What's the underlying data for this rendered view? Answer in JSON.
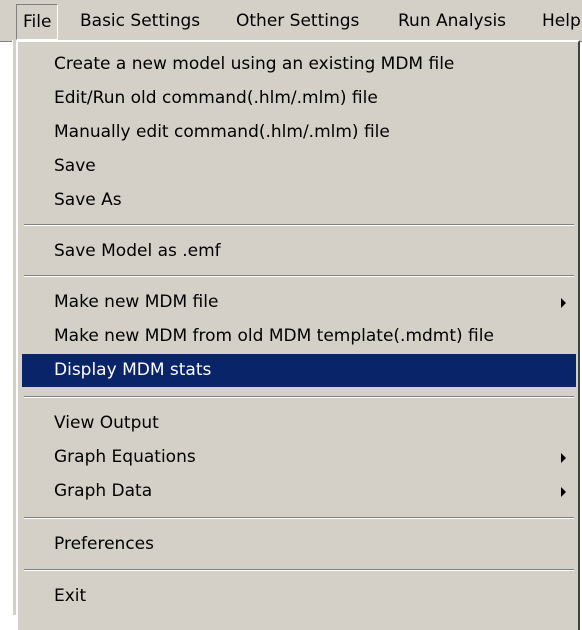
{
  "menubar": {
    "items": [
      {
        "label": "File"
      },
      {
        "label": "Basic Settings"
      },
      {
        "label": "Other Settings"
      },
      {
        "label": "Run Analysis"
      },
      {
        "label": "Help"
      }
    ]
  },
  "file_menu": {
    "items": [
      {
        "label": "Create a new model using an existing MDM file"
      },
      {
        "label": "Edit/Run old command(.hlm/.mlm) file"
      },
      {
        "label": "Manually edit command(.hlm/.mlm) file"
      },
      {
        "label": "Save"
      },
      {
        "label": "Save As"
      },
      {
        "label": "Save Model as .emf"
      },
      {
        "label": "Make new MDM file",
        "submenu_icon": "submenu-arrow-icon"
      },
      {
        "label": "Make new MDM from old MDM template(.mdmt) file"
      },
      {
        "label": "Display MDM stats",
        "highlighted": true
      },
      {
        "label": "View Output"
      },
      {
        "label": "Graph Equations",
        "submenu_icon": "submenu-arrow-icon"
      },
      {
        "label": "Graph Data",
        "submenu_icon": "submenu-arrow-icon"
      },
      {
        "label": "Preferences"
      },
      {
        "label": "Exit"
      }
    ]
  },
  "colors": {
    "menu_background": "#d4d0c8",
    "highlight_background": "#0a246a",
    "highlight_text": "#ffffff"
  }
}
